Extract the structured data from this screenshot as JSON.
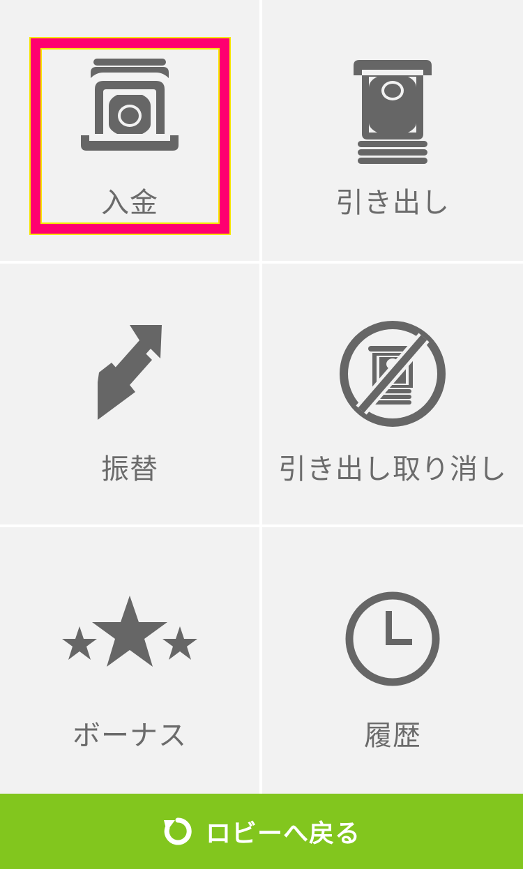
{
  "menu": {
    "deposit": {
      "label": "入金",
      "icon": "deposit-icon"
    },
    "withdraw": {
      "label": "引き出し",
      "icon": "withdraw-icon"
    },
    "transfer": {
      "label": "振替",
      "icon": "transfer-arrows-icon"
    },
    "cancel_withdraw": {
      "label": "引き出し取り消し",
      "icon": "cancel-withdraw-icon"
    },
    "bonus": {
      "label": "ボーナス",
      "icon": "stars-icon"
    },
    "history": {
      "label": "履歴",
      "icon": "clock-icon"
    }
  },
  "footer": {
    "label": "ロビーへ戻る",
    "icon": "refresh-icon"
  },
  "colors": {
    "tile_bg": "#f2f2f2",
    "icon_gray": "#666666",
    "highlight": "#ff0070",
    "footer_green": "#82c61e"
  }
}
